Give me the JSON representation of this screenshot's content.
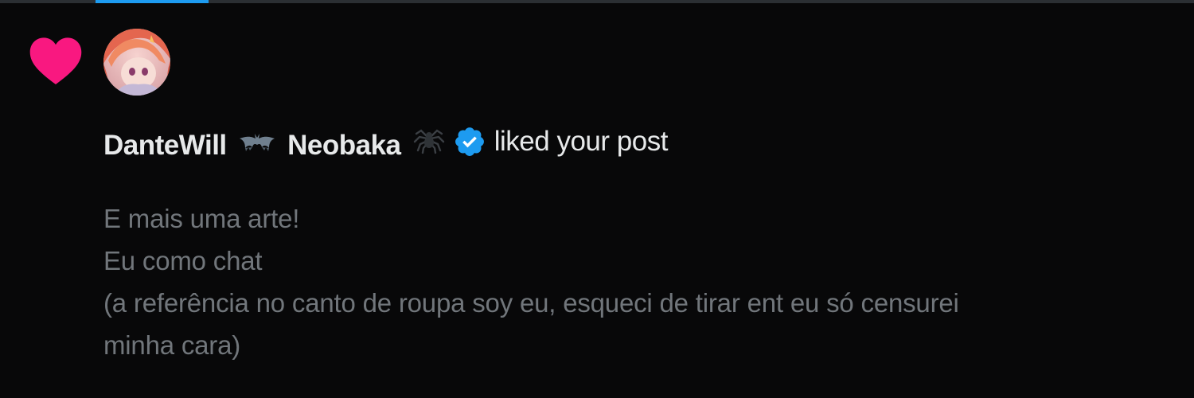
{
  "notification": {
    "type_icon": "heart-icon",
    "user": {
      "display_name_part1": "DanteWill",
      "display_name_part2": "Neobaka",
      "emoji_1": "bat-emoji-icon",
      "emoji_2": "spider-emoji-icon",
      "verified_badge": "verified-badge-icon",
      "avatar": "avatar-image"
    },
    "action_text": "liked your post",
    "post_lines": [
      "E mais uma arte!",
      "Eu como chat",
      "(a referência no canto de roupa soy eu, esqueci de tirar ent eu só censurei",
      "minha cara)"
    ]
  },
  "colors": {
    "background": "#080809",
    "heart": "#f91880",
    "verified": "#1d9bf0",
    "primary_text": "#e7e9ea",
    "secondary_text": "#71767b",
    "tab_indicator": "#1d9bf0"
  }
}
